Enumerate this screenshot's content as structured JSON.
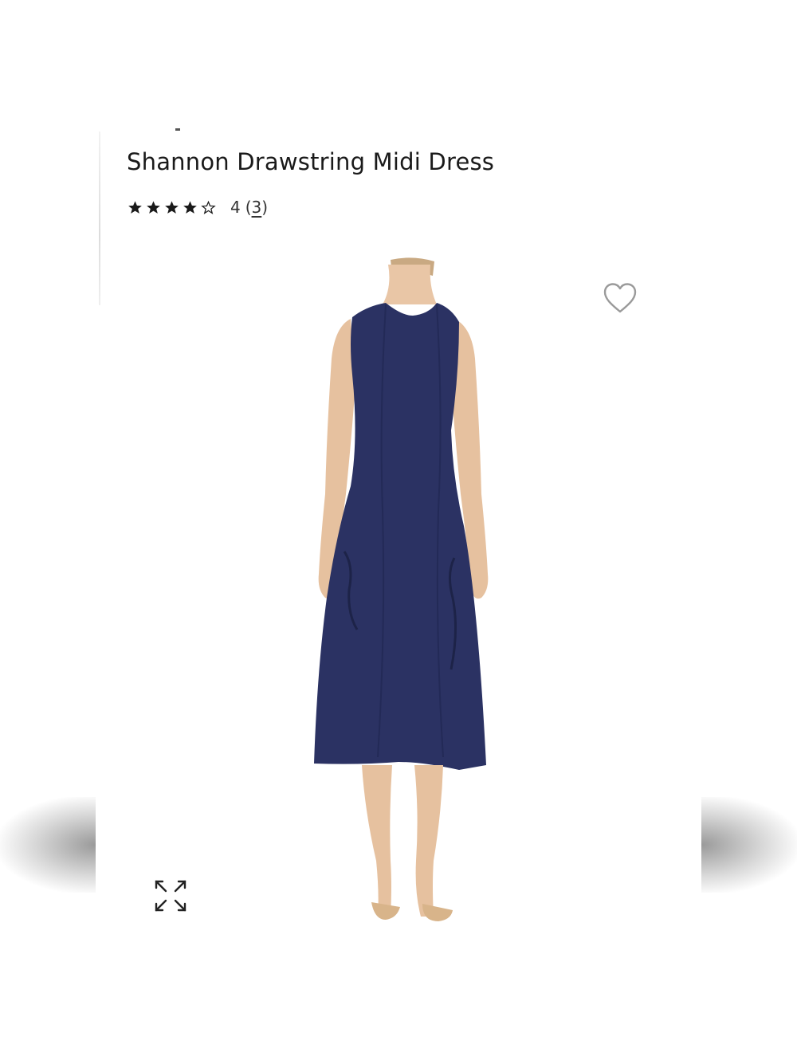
{
  "product": {
    "title": "Shannon Drawstring Midi Dress",
    "rating": {
      "stars_filled": 4,
      "stars_total": 5,
      "value_label": "4",
      "count_open": "(",
      "count": "3",
      "count_close": ")"
    },
    "image": {
      "description_icon": "dress-photo",
      "dress_color": "#2b3263"
    }
  },
  "icons": {
    "wishlist": "heart-outline-icon",
    "expand": "expand-arrows-icon",
    "star": "star-icon"
  },
  "colors": {
    "text": "#1a1a1a",
    "icon": "#222222",
    "heart": "#9a9a9a"
  }
}
